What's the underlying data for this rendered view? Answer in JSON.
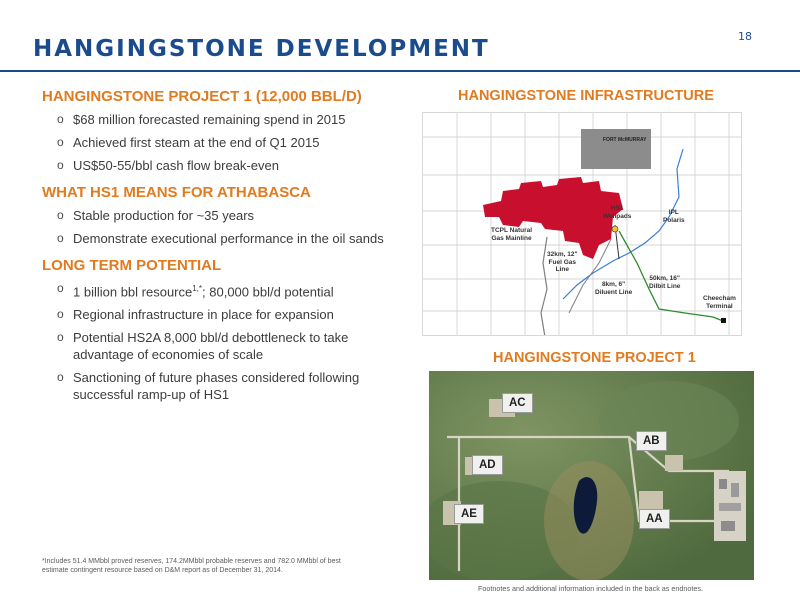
{
  "page_number": "18",
  "title": "HANGINGSTONE DEVELOPMENT",
  "sections": [
    {
      "heading": "HANGINGSTONE PROJECT 1 (12,000 BBL/D)",
      "bullets": [
        "$68 million forecasted remaining spend in 2015",
        "Achieved first steam at the end of Q1 2015",
        "US$50-55/bbl cash flow break-even"
      ]
    },
    {
      "heading": "WHAT HS1 MEANS FOR ATHABASCA",
      "bullets": [
        "Stable production for ~35 years",
        "Demonstrate executional performance in the oil sands"
      ]
    },
    {
      "heading": "LONG TERM POTENTIAL",
      "bullets": [
        "1 billion bbl resource",
        "Regional infrastructure in place for expansion",
        "Potential HS2A 8,000 bbl/d debottleneck to take advantage of economies of scale",
        "Sanctioning of future phases considered following successful ramp-up of HS1"
      ],
      "bullet0_superscript": "1,*",
      "bullet0_suffix": "; 80,000 bbl/d potential"
    }
  ],
  "bullet_glyph": "o",
  "footnote_left": "*Includes 51.4 MMbbl proved reserves, 174.2MMbbl probable reserves and 782.0 MMbbl of best estimate contingent resource based on D&M report as of December 31, 2014.",
  "footnote_right": "Footnotes and additional information included in the back as endnotes.",
  "infrastructure": {
    "heading": "HANGINGSTONE INFRASTRUCTURE",
    "labels": {
      "hs1": "HS1",
      "hs1_sub": "Wellpads",
      "fort_mcmurray": "FORT McMURRAY",
      "ipl": "IPL",
      "ipl_sub": "Polaris",
      "tcpl": "TCPL Natural",
      "tcpl_sub": "Gas Mainline",
      "fuel": "32km, 12\"",
      "fuel_2": "Fuel Gas",
      "fuel_3": "Line",
      "diluent": "8km, 6\"",
      "diluent_2": "Diluent Line",
      "dilbit": "50km, 16\"",
      "dilbit_2": "Dilbit Line",
      "cheecham": "Cheecham",
      "cheecham_2": "Terminal"
    },
    "colors": {
      "lease": "#c8102e",
      "town": "#8c8c8c",
      "ipl": "#3b7dd8",
      "fuel": "#7f7f7f",
      "dilbit": "#2e8b2e"
    }
  },
  "project": {
    "heading": "HANGINGSTONE PROJECT 1",
    "pads": [
      "AC",
      "AB",
      "AD",
      "AE",
      "AA"
    ]
  }
}
